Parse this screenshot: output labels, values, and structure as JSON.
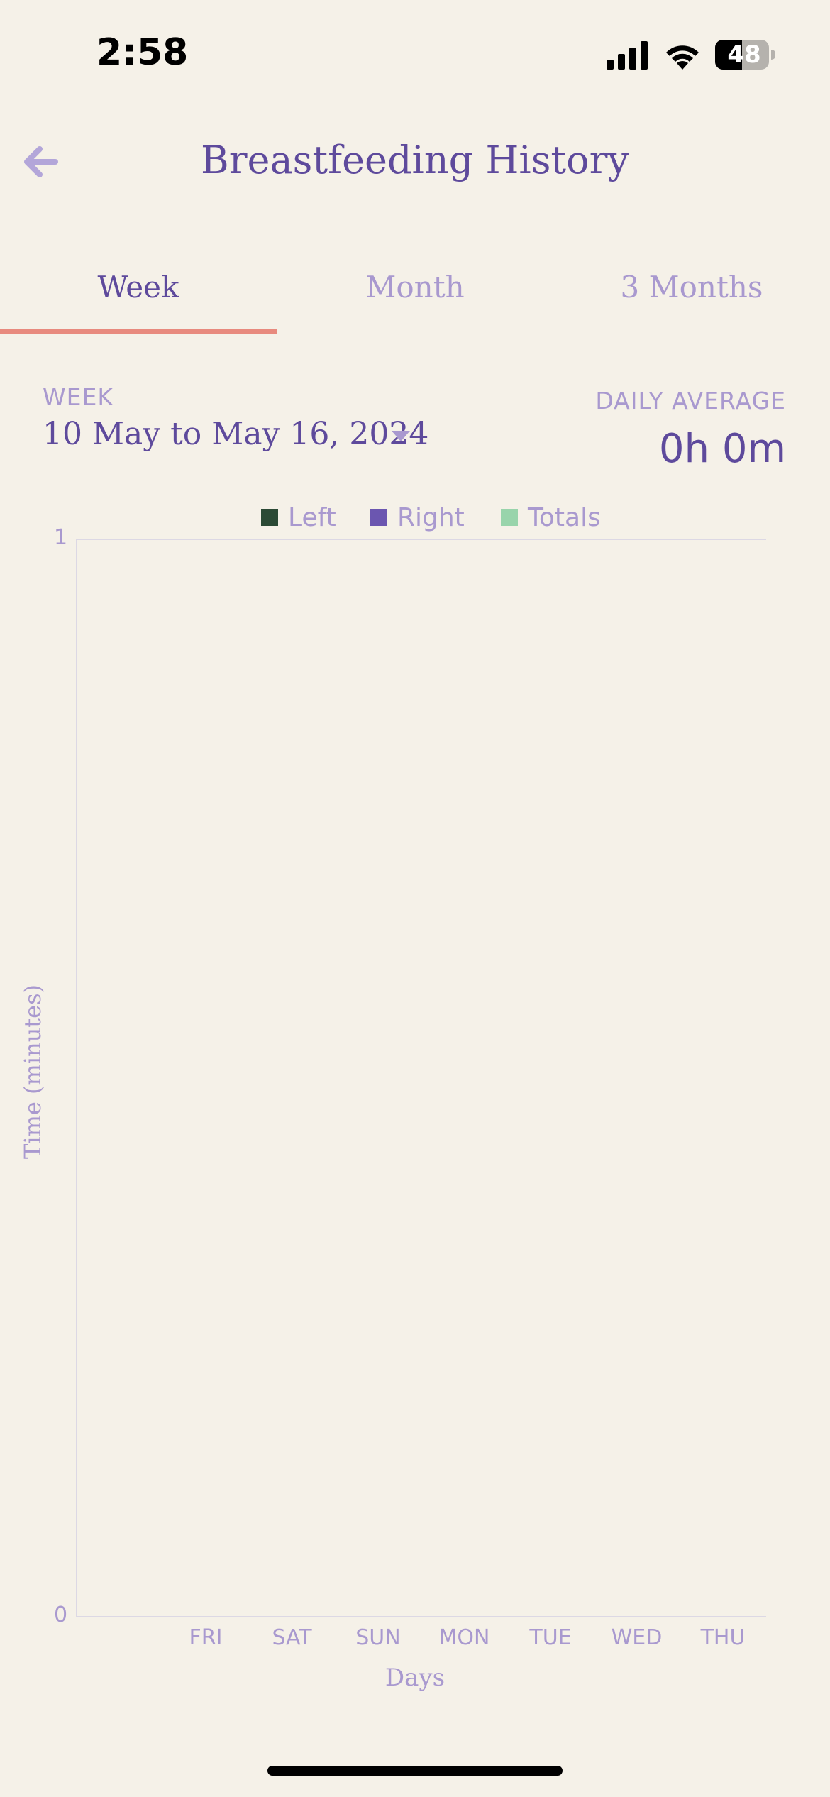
{
  "status_bar": {
    "time": "2:58",
    "battery": "48",
    "icons": [
      "signal-icon",
      "wifi-icon",
      "battery-icon"
    ]
  },
  "header": {
    "title": "Breastfeeding History",
    "back_icon": "back-arrow-icon"
  },
  "tabs": [
    {
      "label": "Week",
      "active": true
    },
    {
      "label": "Month",
      "active": false
    },
    {
      "label": "3 Months",
      "active": false
    }
  ],
  "week_selector": {
    "label": "WEEK",
    "range": "10 May to May 16, 2024",
    "dropdown_icon": "caret-down-icon"
  },
  "daily_average": {
    "label": "DAILY AVERAGE",
    "value": "0h 0m"
  },
  "colors": {
    "background": "#f5f1e8",
    "primary": "#5e4a9c",
    "muted": "#a999cf",
    "tab_indicator": "#e88a7e"
  },
  "chart_data": {
    "type": "bar",
    "categories": [
      "FRI",
      "SAT",
      "SUN",
      "MON",
      "TUE",
      "WED",
      "THU"
    ],
    "series": [
      {
        "name": "Left",
        "color": "#2b4a35",
        "values": [
          0,
          0,
          0,
          0,
          0,
          0,
          0
        ]
      },
      {
        "name": "Right",
        "color": "#6b56b0",
        "values": [
          0,
          0,
          0,
          0,
          0,
          0,
          0
        ]
      },
      {
        "name": "Totals",
        "color": "#98d4ab",
        "values": [
          0,
          0,
          0,
          0,
          0,
          0,
          0
        ]
      }
    ],
    "xlabel": "Days",
    "ylabel": "Time (minutes)",
    "ylim": [
      0,
      1
    ],
    "yticks": [
      "0",
      "1"
    ],
    "legend_position": "top"
  }
}
